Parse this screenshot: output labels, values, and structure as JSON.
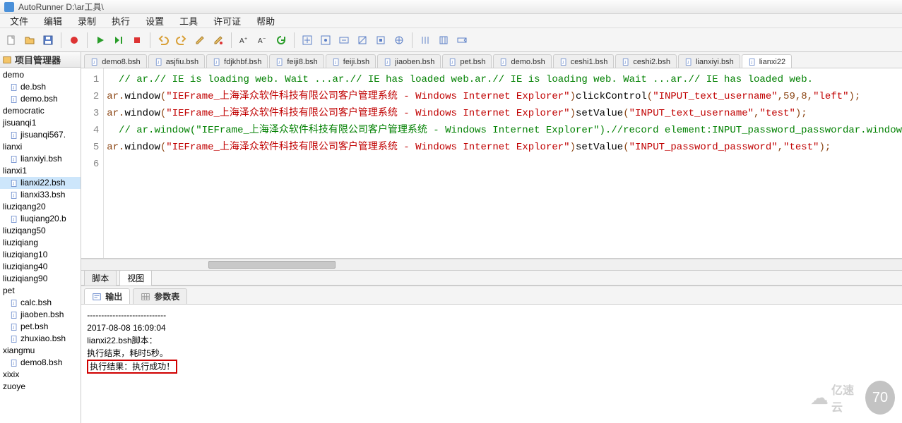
{
  "titlebar": {
    "title": "AutoRunner  D:\\ar工具\\"
  },
  "menu": {
    "file": "文件",
    "edit": "编辑",
    "record": "录制",
    "run": "执行",
    "settings": "设置",
    "tools": "工具",
    "license": "许可证",
    "help": "帮助"
  },
  "sidebar": {
    "title": "项目管理器",
    "items": [
      {
        "t": "folder",
        "label": "demo"
      },
      {
        "t": "file",
        "label": "de.bsh"
      },
      {
        "t": "file",
        "label": "demo.bsh"
      },
      {
        "t": "folder",
        "label": "democratic"
      },
      {
        "t": "folder",
        "label": "jisuanqi1"
      },
      {
        "t": "file",
        "label": "jisuanqi567."
      },
      {
        "t": "folder",
        "label": "lianxi"
      },
      {
        "t": "file",
        "label": "lianxiyi.bsh"
      },
      {
        "t": "folder",
        "label": "lianxi1"
      },
      {
        "t": "file",
        "label": "lianxi22.bsh",
        "selected": true
      },
      {
        "t": "file",
        "label": "lianxi33.bsh"
      },
      {
        "t": "folder",
        "label": "liuziqang20"
      },
      {
        "t": "file",
        "label": "liuqiang20.b"
      },
      {
        "t": "folder",
        "label": "liuziqang50"
      },
      {
        "t": "folder",
        "label": "liuziqiang"
      },
      {
        "t": "folder",
        "label": "liuziqiang10"
      },
      {
        "t": "folder",
        "label": "liuziqiang40"
      },
      {
        "t": "folder",
        "label": "liuziqiang90"
      },
      {
        "t": "folder",
        "label": "pet"
      },
      {
        "t": "file",
        "label": "calc.bsh"
      },
      {
        "t": "file",
        "label": "jiaoben.bsh"
      },
      {
        "t": "file",
        "label": "pet.bsh"
      },
      {
        "t": "file",
        "label": "zhuxiao.bsh"
      },
      {
        "t": "folder",
        "label": "xiangmu"
      },
      {
        "t": "file",
        "label": "demo8.bsh"
      },
      {
        "t": "folder",
        "label": "xixix"
      },
      {
        "t": "folder",
        "label": "zuoye"
      }
    ]
  },
  "editor_tabs": [
    "demo8.bsh",
    "asjfiu.bsh",
    "fdjkhbf.bsh",
    "feiji8.bsh",
    "feiji.bsh",
    "jiaoben.bsh",
    "pet.bsh",
    "demo.bsh",
    "ceshi1.bsh",
    "ceshi2.bsh",
    "lianxiyi.bsh",
    "lianxi22"
  ],
  "code": {
    "l1": "  // ar.// IE is loading web. Wait ...ar.// IE has loaded web.ar.// IE is loading web. Wait ...ar.// IE has loaded web.",
    "l2": {
      "pre": "ar.",
      "m": "window",
      "args": [
        "\"IEFrame_上海泽众软件科技有限公司客户管理系统 - Windows Internet Explorer\""
      ],
      "post": ".clickControl(",
      "args2": [
        "\"INPUT_text_username\"",
        ",59,8,",
        "\"left\""
      ],
      "end": ");"
    },
    "l3": {
      "pre": "ar.",
      "m": "window",
      "args": [
        "\"IEFrame_上海泽众软件科技有限公司客户管理系统 - Windows Internet Explorer\""
      ],
      "post": ".setValue(",
      "args2": [
        "\"INPUT_text_username\"",
        ",",
        "\"test\""
      ],
      "end": ");"
    },
    "l4": "  // ar.window(\"IEFrame_上海泽众软件科技有限公司客户管理系统 - Windows Internet Explorer\").//record element:INPUT_password_passwordar.window",
    "l5": {
      "pre": "ar.",
      "m": "window",
      "args": [
        "\"IEFrame_上海泽众软件科技有限公司客户管理系统 - Windows Internet Explorer\""
      ],
      "post": ".setValue(",
      "args2": [
        "\"INPUT_password_password\"",
        ",",
        "\"test\""
      ],
      "end": ");"
    }
  },
  "bottom_tabs": {
    "script": "脚本",
    "view": "视图"
  },
  "lower_tabs": {
    "output": "输出",
    "params": "参数表"
  },
  "output": {
    "sep": "----------------------------",
    "ts": "2017-08-08 16:09:04",
    "script": "lianxi22.bsh脚本：",
    "done": "执行结束，耗时5秒。",
    "result": "执行结果：执行成功！"
  },
  "watermark": {
    "text": "亿速云",
    "num": "70"
  }
}
